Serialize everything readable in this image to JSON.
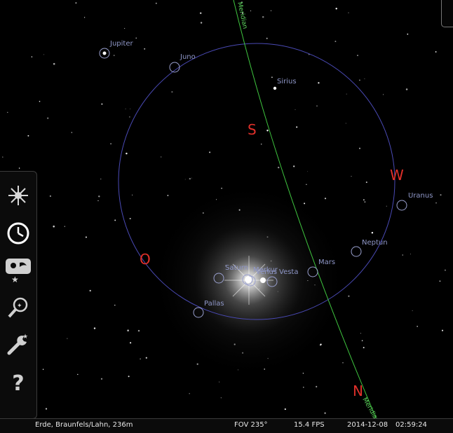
{
  "sky": {
    "objects": [
      {
        "name": "Jupiter"
      },
      {
        "name": "Juno"
      },
      {
        "name": "Sirius"
      },
      {
        "name": "Uranus"
      },
      {
        "name": "Neptun"
      },
      {
        "name": "Mars"
      },
      {
        "name": "Saturn"
      },
      {
        "name": "Merkur"
      },
      {
        "name": "Venus"
      },
      {
        "name": "Vesta"
      },
      {
        "name": "Pallas"
      }
    ],
    "cardinals": {
      "south": "S",
      "west": "W",
      "east": "O",
      "north": "N"
    },
    "meridian_label": "Meridian",
    "colors": {
      "horizon": "#4a4ab5",
      "meridian": "#3fc63f",
      "cardinal": "#e0302a",
      "label": "#8f97c8"
    }
  },
  "sidebar": {
    "buttons": [
      {
        "icon": "sky-culture-icon"
      },
      {
        "icon": "clock-icon"
      },
      {
        "icon": "sky-view-icon"
      },
      {
        "icon": "search-icon"
      },
      {
        "icon": "wrench-icon"
      },
      {
        "icon": "help-icon"
      }
    ]
  },
  "statusbar": {
    "location": "Erde, Braunfels/Lahn, 236m",
    "fov": "FOV 235°",
    "fps": "15.4 FPS",
    "date": "2014-12-08",
    "time": "02:59:24"
  }
}
